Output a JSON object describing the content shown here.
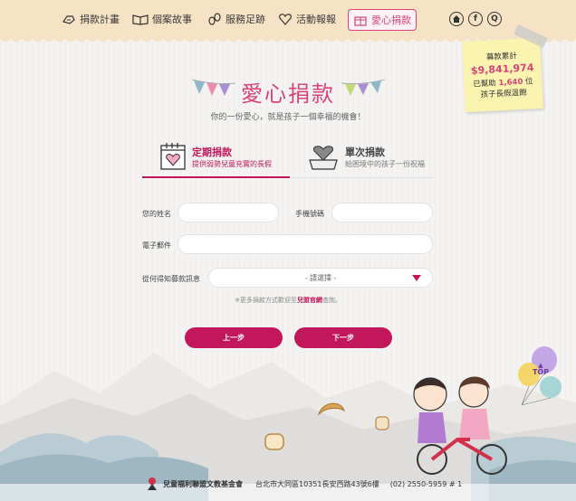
{
  "nav": {
    "items": [
      {
        "label": "捐款計畫",
        "icon": "handshake-icon"
      },
      {
        "label": "個案故事",
        "icon": "book-icon"
      },
      {
        "label": "服務足跡",
        "icon": "footprint-icon"
      },
      {
        "label": "活動報報",
        "icon": "heart-icon"
      },
      {
        "label": "愛心捐款",
        "icon": "gift-icon"
      }
    ],
    "home_icon": "home-icon",
    "facebook_label": "f",
    "search_label": "Q"
  },
  "note": {
    "line1": "募款累計",
    "amount": "$9,841,974",
    "line2_prefix": "已幫助",
    "count": "1,640",
    "line2_suffix": "位",
    "line3": "孩子長假溫飽"
  },
  "page": {
    "title": "愛心捐款",
    "subtitle": "你的一份愛心，就是孩子一個幸福的機會！"
  },
  "tabs": [
    {
      "name": "定期捐款",
      "desc": "提供弱勢兒童充實的長假",
      "active": true
    },
    {
      "name": "單次捐款",
      "desc": "給困境中的孩子一份祝福",
      "active": false
    }
  ],
  "form": {
    "name_label": "您的姓名",
    "phone_label": "手機號碼",
    "email_label": "電子郵件",
    "source_label": "從何得知募款訊息",
    "source_value": "- 請選擇 -",
    "hint_prefix": "※更多捐款方式歡迎至",
    "hint_link": "兒盟官網",
    "hint_suffix": "查詢。"
  },
  "buttons": {
    "prev": "上一步",
    "next": "下一步"
  },
  "top_button": "TOP",
  "footer": {
    "org": "兒童福利聯盟文教基金會",
    "address": "台北市大同區10351長安西路43號6樓",
    "phone": "(02) 2550-5959 # 1"
  },
  "colors": {
    "accent": "#c2185b",
    "nav_bg": "#f6e3c5",
    "note_bg": "#fbf3b0"
  }
}
